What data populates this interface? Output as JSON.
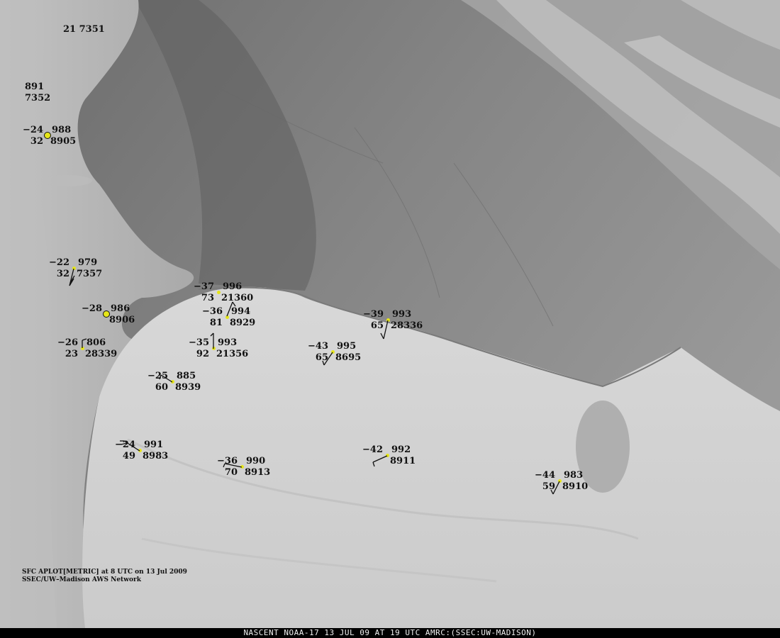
{
  "plot": {
    "caption_line1": "SFC APLOT[METRIC] at 8 UTC on 13 Jul 2009",
    "caption_line2": "SSEC/UW–Madison AWS Network",
    "footer": "NASCENT NOAA-17 13 JUL 09 AT 19 UTC AMRC:(SSEC:UW-MADISON)"
  },
  "colors": {
    "station_dot": "#e6e619",
    "text": "#111111",
    "footer_bg": "#000000",
    "footer_text": "#f0f0f0"
  },
  "labels": [
    {
      "name": "station-21-7351",
      "text": "21  7351"
    },
    {
      "name": "station-891-7352-a",
      "text": "891"
    },
    {
      "name": "station-891-7352-b",
      "text": "7352"
    }
  ],
  "stations": [
    {
      "temp": "−24",
      "pressure": "988",
      "rh": "32",
      "id": "8905",
      "hollow": true,
      "barb": "none"
    },
    {
      "temp": "−22",
      "pressure": "979",
      "rh": "32",
      "id": "7357",
      "hollow": false,
      "barb": "sw"
    },
    {
      "temp": "−28",
      "pressure": "986",
      "rh": "",
      "id": "8906",
      "hollow": true,
      "barb": "none"
    },
    {
      "temp": "−26",
      "pressure": "806",
      "rh": "23",
      "id": "28339",
      "hollow": false,
      "barb": "n"
    },
    {
      "temp": "−37",
      "pressure": "996",
      "rh": "73",
      "id": "21360",
      "hollow": false,
      "barb": "none"
    },
    {
      "temp": "−36",
      "pressure": "994",
      "rh": "81",
      "id": "8929",
      "hollow": false,
      "barb": "ne"
    },
    {
      "temp": "−35",
      "pressure": "993",
      "rh": "92",
      "id": "21356",
      "hollow": false,
      "barb": "n"
    },
    {
      "temp": "−25",
      "pressure": "885",
      "rh": "60",
      "id": "8939",
      "hollow": false,
      "barb": "nw"
    },
    {
      "temp": "−43",
      "pressure": "995",
      "rh": "65",
      "id": "8695",
      "hollow": false,
      "barb": "s"
    },
    {
      "temp": "−39",
      "pressure": "993",
      "rh": "65",
      "id": "28336",
      "hollow": false,
      "barb": "ssw"
    },
    {
      "temp": "−24",
      "pressure": "991",
      "rh": "49",
      "id": "8983",
      "hollow": false,
      "barb": "nw"
    },
    {
      "temp": "−36",
      "pressure": "990",
      "rh": "70",
      "id": "8913",
      "hollow": false,
      "barb": "w"
    },
    {
      "temp": "−42",
      "pressure": "992",
      "rh": "",
      "id": "8911",
      "hollow": false,
      "barb": "sw"
    },
    {
      "temp": "−44",
      "pressure": "983",
      "rh": "59",
      "id": "8910",
      "hollow": false,
      "barb": "s"
    }
  ]
}
